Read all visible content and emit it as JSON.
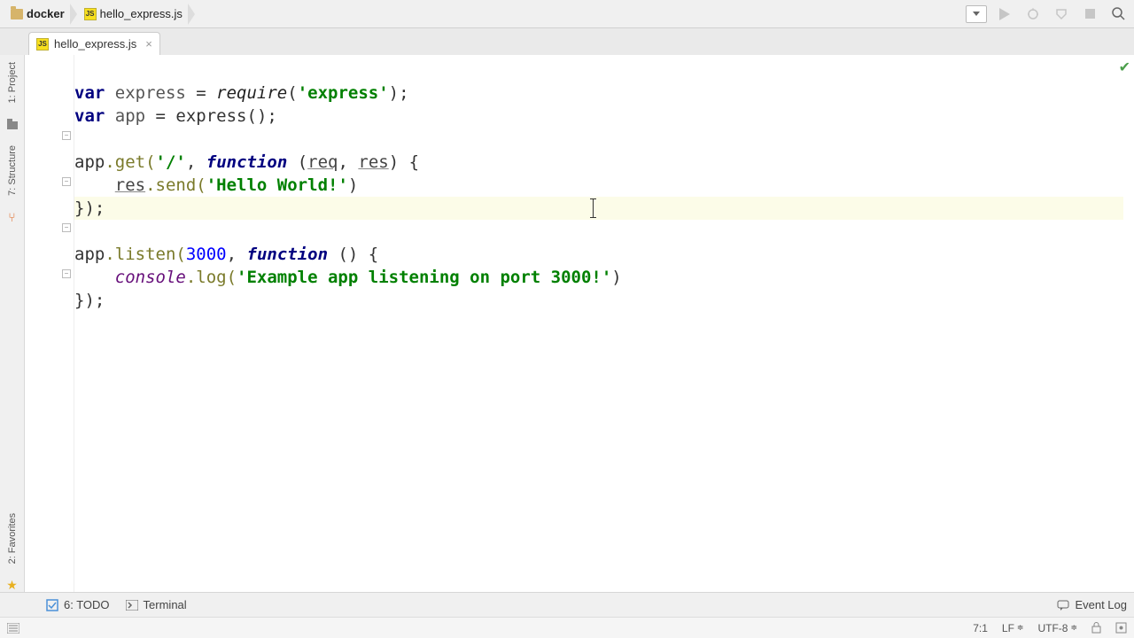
{
  "breadcrumbs": [
    "docker",
    "hello_express.js"
  ],
  "tab": {
    "name": "hello_express.js"
  },
  "left_rail": {
    "project": "1: Project",
    "structure": "7: Structure",
    "favorites": "2: Favorites"
  },
  "code_lines": {
    "l1_var": "var ",
    "l1_express": "express",
    "l1_eq": " = ",
    "l1_require": "require",
    "l1_paren_open": "(",
    "l1_str": "'express'",
    "l1_end": ");",
    "l2_var": "var ",
    "l2_app": "app",
    "l2_eq": " = ",
    "l2_express_call": "express",
    "l2_end": "();",
    "l4_app": "app",
    "l4_get": ".get(",
    "l4_str": "'/'",
    "l4_comma": ", ",
    "l4_func": "function ",
    "l4_paren_open": "(",
    "l4_req": "req",
    "l4_comma2": ", ",
    "l4_res": "res",
    "l4_end": ") {",
    "l5_indent": "    ",
    "l5_res": "res",
    "l5_send": ".send(",
    "l5_str": "'Hello World!'",
    "l5_end": ")",
    "l6": "});",
    "l8_app": "app",
    "l8_listen": ".listen(",
    "l8_num": "3000",
    "l8_comma": ", ",
    "l8_func": "function ",
    "l8_end": "() {",
    "l9_indent": "    ",
    "l9_console": "console",
    "l9_log": ".log(",
    "l9_str": "'Example app listening on port 3000!'",
    "l9_end": ")",
    "l10": "});"
  },
  "bottom_tools": {
    "todo": "6: TODO",
    "terminal": "Terminal",
    "event_log": "Event Log"
  },
  "status": {
    "position": "7:1",
    "line_ending": "LF",
    "encoding": "UTF-8"
  }
}
